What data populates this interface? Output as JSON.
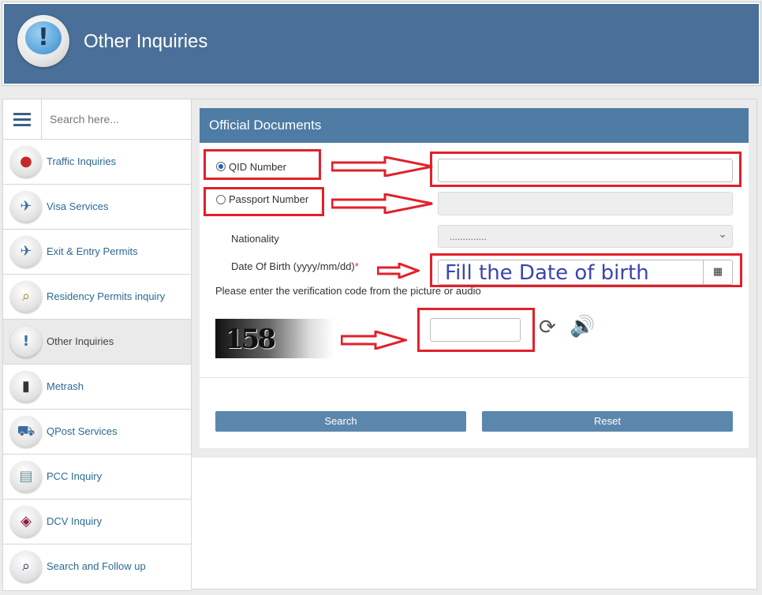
{
  "header": {
    "title": "Other Inquiries",
    "logo_icon": "exclamation-bubble-icon"
  },
  "sidebar": {
    "search_placeholder": "Search here...",
    "items": [
      {
        "label": "Traffic Inquiries",
        "icon": "traffic-light-icon",
        "active": false
      },
      {
        "label": "Visa Services",
        "icon": "visa-icon",
        "active": false
      },
      {
        "label": "Exit & Entry Permits",
        "icon": "airplane-icon",
        "active": false
      },
      {
        "label": "Residency Permits inquiry",
        "icon": "residency-icon",
        "active": false
      },
      {
        "label": "Other Inquiries",
        "icon": "exclamation-icon",
        "active": true
      },
      {
        "label": "Metrash",
        "icon": "phone-icon",
        "active": false
      },
      {
        "label": "QPost Services",
        "icon": "delivery-truck-icon",
        "active": false
      },
      {
        "label": "PCC Inquiry",
        "icon": "certificate-icon",
        "active": false
      },
      {
        "label": "DCV Inquiry",
        "icon": "dcv-icon",
        "active": false
      },
      {
        "label": "Search and Follow up",
        "icon": "search-person-icon",
        "active": false
      }
    ]
  },
  "form": {
    "title": "Official Documents",
    "qid_label": "QID Number",
    "passport_label": "Passport Number",
    "nationality_label": "Nationality",
    "nationality_value": "..............",
    "dob_label": "Date Of Birth (yyyy/mm/dd)",
    "required_mark": "*",
    "dob_value": "Fill the Date of birth",
    "verification_text": "Please enter the verification code from the picture or audio",
    "captcha_text": "158",
    "search_label": "Search",
    "reset_label": "Reset"
  },
  "colors": {
    "header": "#4a7099",
    "panel_header": "#4e7ca4",
    "button": "#5c87ad",
    "annotation": "#e2202a"
  }
}
